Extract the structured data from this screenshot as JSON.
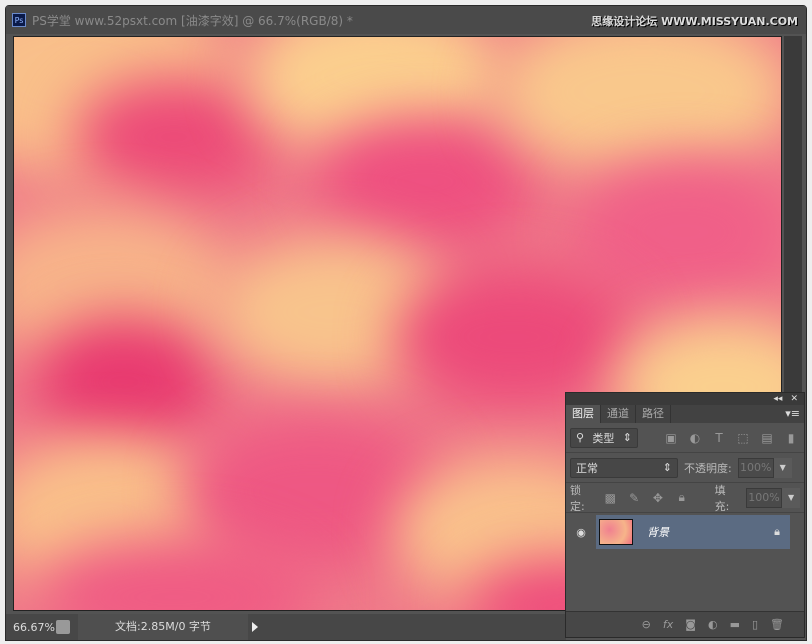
{
  "window": {
    "app_icon": "Ps",
    "title": "PS学堂 www.52psxt.com [油漆字效] @ 66.7%(RGB/8) *",
    "watermark": "思缘设计论坛 WWW.MISSYUAN.COM"
  },
  "status": {
    "zoom": "66.67%",
    "doc_info": "文档:2.85M/0 字节"
  },
  "layers_panel": {
    "tabs": [
      {
        "label": "图层",
        "active": true
      },
      {
        "label": "通道"
      },
      {
        "label": "路径"
      }
    ],
    "filter": {
      "icon": "search-icon",
      "label": "类型"
    },
    "blend_mode": "正常",
    "opacity_label": "不透明度:",
    "opacity_value": "100%",
    "lock_label": "锁定:",
    "fill_label": "填充:",
    "fill_value": "100%",
    "layers": [
      {
        "name": "背景",
        "visible": true,
        "locked": true,
        "selected": true
      }
    ],
    "colors": {
      "selected_layer": "#5b6b82",
      "canvas_pink": "#ee4a78",
      "canvas_yellow": "#fbd08c"
    }
  }
}
